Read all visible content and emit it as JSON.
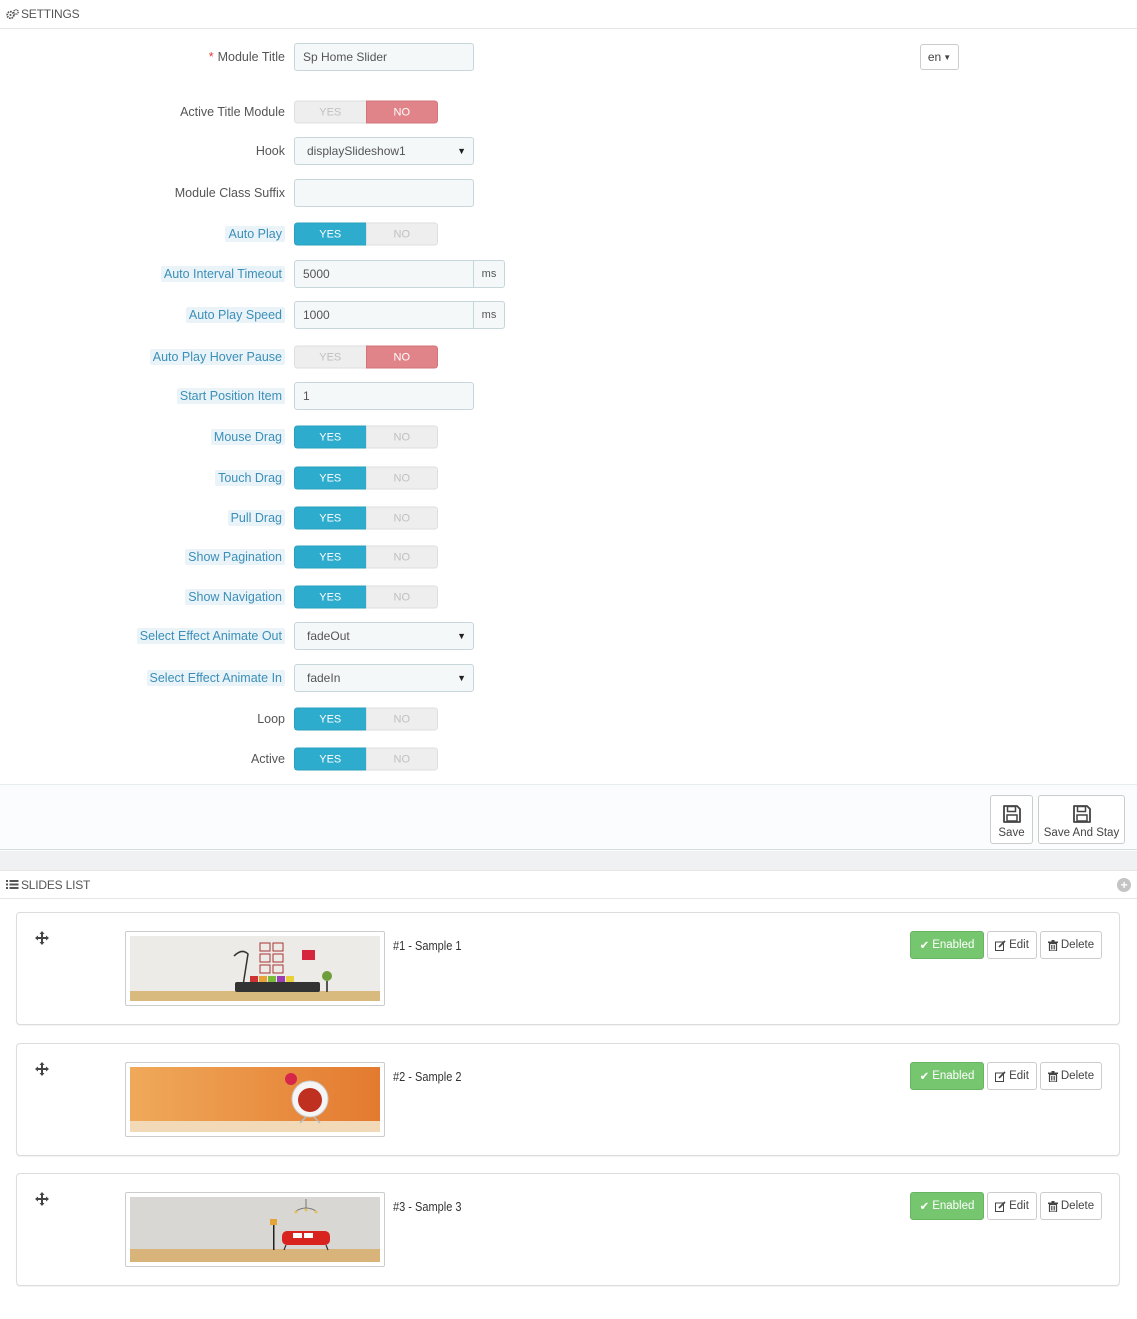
{
  "settings_heading": "SETTINGS",
  "lang": "en",
  "fields": {
    "module_title": {
      "label": "Module Title",
      "value": "Sp Home Slider"
    },
    "active_title": {
      "label": "Active Title Module",
      "yes": "YES",
      "no": "NO",
      "state": "no"
    },
    "hook": {
      "label": "Hook",
      "value": "displaySlideshow1"
    },
    "class_suffix": {
      "label": "Module Class Suffix",
      "value": ""
    },
    "auto_play": {
      "label": "Auto Play",
      "yes": "YES",
      "no": "NO",
      "state": "yes"
    },
    "interval": {
      "label": "Auto Interval Timeout",
      "value": "5000",
      "unit": "ms"
    },
    "play_speed": {
      "label": "Auto Play Speed",
      "value": "1000",
      "unit": "ms"
    },
    "hover_pause": {
      "label": "Auto Play Hover Pause",
      "yes": "YES",
      "no": "NO",
      "state": "no"
    },
    "start_pos": {
      "label": "Start Position Item",
      "value": "1"
    },
    "mouse_drag": {
      "label": "Mouse Drag",
      "yes": "YES",
      "no": "NO",
      "state": "yes"
    },
    "touch_drag": {
      "label": "Touch Drag",
      "yes": "YES",
      "no": "NO",
      "state": "yes"
    },
    "pull_drag": {
      "label": "Pull Drag",
      "yes": "YES",
      "no": "NO",
      "state": "yes"
    },
    "show_pagination": {
      "label": "Show Pagination",
      "yes": "YES",
      "no": "NO",
      "state": "yes"
    },
    "show_navigation": {
      "label": "Show Navigation",
      "yes": "YES",
      "no": "NO",
      "state": "yes"
    },
    "effect_out": {
      "label": "Select Effect Animate Out",
      "value": "fadeOut"
    },
    "effect_in": {
      "label": "Select Effect Animate In",
      "value": "fadeIn"
    },
    "loop": {
      "label": "Loop",
      "yes": "YES",
      "no": "NO",
      "state": "yes"
    },
    "active": {
      "label": "Active",
      "yes": "YES",
      "no": "NO",
      "state": "yes"
    }
  },
  "footer": {
    "save": "Save",
    "save_stay": "Save And Stay"
  },
  "slides_heading": "SLIDES LIST",
  "slides": [
    {
      "title": "#1 - Sample 1",
      "status": "Enabled",
      "edit": "Edit",
      "delete": "Delete"
    },
    {
      "title": "#2 - Sample 2",
      "status": "Enabled",
      "edit": "Edit",
      "delete": "Delete"
    },
    {
      "title": "#3 - Sample 3",
      "status": "Enabled",
      "edit": "Edit",
      "delete": "Delete"
    }
  ],
  "colors": {
    "accent_yes": "#2eacce",
    "accent_no": "#e08489",
    "enabled": "#76c56f",
    "hint_text": "#3b8fb8"
  }
}
